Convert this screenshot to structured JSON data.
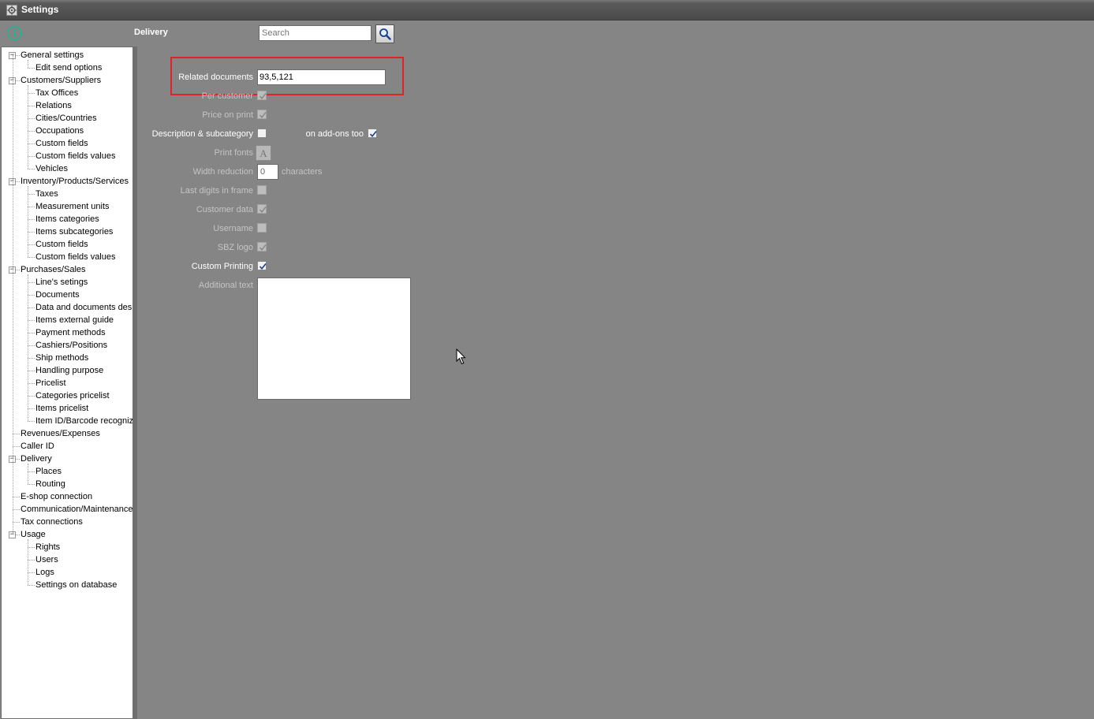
{
  "window": {
    "title": "Settings"
  },
  "header": {
    "section_title": "Delivery",
    "search": {
      "placeholder": "Search",
      "value": ""
    }
  },
  "tree": [
    {
      "label": "General settings",
      "level": 0,
      "expandable": true
    },
    {
      "label": "Edit send options",
      "level": 1
    },
    {
      "label": "Customers/Suppliers",
      "level": 0,
      "expandable": true
    },
    {
      "label": "Tax Offices",
      "level": 1
    },
    {
      "label": "Relations",
      "level": 1
    },
    {
      "label": "Cities/Countries",
      "level": 1
    },
    {
      "label": "Occupations",
      "level": 1
    },
    {
      "label": "Custom fields",
      "level": 1
    },
    {
      "label": "Custom fields values",
      "level": 1
    },
    {
      "label": "Vehicles",
      "level": 1
    },
    {
      "label": "Inventory/Products/Services",
      "level": 0,
      "expandable": true
    },
    {
      "label": "Taxes",
      "level": 1
    },
    {
      "label": "Measurement units",
      "level": 1
    },
    {
      "label": "Items categories",
      "level": 1
    },
    {
      "label": "Items subcategories",
      "level": 1
    },
    {
      "label": "Custom fields",
      "level": 1
    },
    {
      "label": "Custom fields values",
      "level": 1
    },
    {
      "label": "Purchases/Sales",
      "level": 0,
      "expandable": true
    },
    {
      "label": "Line's setings",
      "level": 1
    },
    {
      "label": "Documents",
      "level": 1
    },
    {
      "label": "Data and documents desi",
      "level": 1
    },
    {
      "label": "Items external guide",
      "level": 1
    },
    {
      "label": "Payment methods",
      "level": 1
    },
    {
      "label": "Cashiers/Positions",
      "level": 1
    },
    {
      "label": "Ship methods",
      "level": 1
    },
    {
      "label": "Handling purpose",
      "level": 1
    },
    {
      "label": "Pricelist",
      "level": 1
    },
    {
      "label": "Categories pricelist",
      "level": 1
    },
    {
      "label": "Items pricelist",
      "level": 1
    },
    {
      "label": "Item ID/Barcode recognize",
      "level": 1
    },
    {
      "label": "Revenues/Expenses",
      "level": 0
    },
    {
      "label": "Caller ID",
      "level": 0
    },
    {
      "label": "Delivery",
      "level": 0,
      "expandable": true
    },
    {
      "label": "Places",
      "level": 1
    },
    {
      "label": "Routing",
      "level": 1
    },
    {
      "label": "E-shop connection",
      "level": 0
    },
    {
      "label": "Communication/Maintenance",
      "level": 0
    },
    {
      "label": "Tax connections",
      "level": 0
    },
    {
      "label": "Usage",
      "level": 0,
      "expandable": true
    },
    {
      "label": "Rights",
      "level": 1
    },
    {
      "label": "Users",
      "level": 1
    },
    {
      "label": "Logs",
      "level": 1
    },
    {
      "label": "Settings on database",
      "level": 1
    }
  ],
  "form": {
    "related_documents": {
      "label": "Related documents",
      "value": "93,5,121"
    },
    "per_customer": {
      "label": "Per customer",
      "checked": true,
      "enabled": false
    },
    "price_on_print": {
      "label": "Price on print",
      "checked": true,
      "enabled": false
    },
    "description_subcategory": {
      "label": "Description & subcategory",
      "checked": false,
      "enabled": true
    },
    "on_addons_too": {
      "label": "on add-ons too",
      "checked": true,
      "enabled": true
    },
    "print_fonts": {
      "label": "Print fonts",
      "button_glyph": "A"
    },
    "width_reduction": {
      "label": "Width reduction",
      "value": "0",
      "suffix": "characters"
    },
    "last_digits_in_frame": {
      "label": "Last digits in frame",
      "checked": false,
      "enabled": false
    },
    "customer_data": {
      "label": "Customer data",
      "checked": true,
      "enabled": false
    },
    "username": {
      "label": "Username",
      "checked": false,
      "enabled": false
    },
    "sbz_logo": {
      "label": "SBZ logo",
      "checked": true,
      "enabled": false
    },
    "custom_printing": {
      "label": "Custom Printing",
      "checked": true,
      "enabled": true
    },
    "additional_text": {
      "label": "Additional text",
      "value": ""
    }
  },
  "colors": {
    "background": "#858585",
    "highlight": "#e0232b",
    "info_icon": "#1fb58f"
  },
  "icons": [
    "gear-icon",
    "info-icon",
    "search-icon",
    "font-icon",
    "checkmark-icon",
    "mouse-cursor-icon"
  ]
}
